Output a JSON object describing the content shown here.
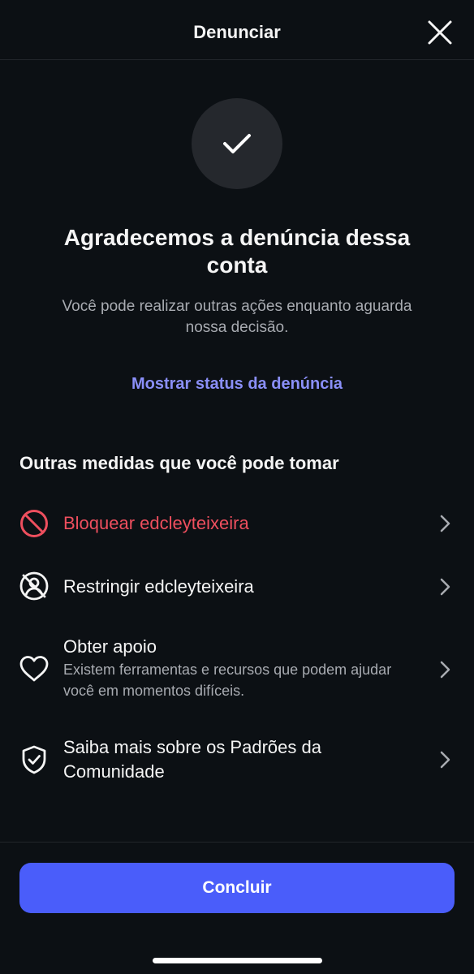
{
  "header": {
    "title": "Denunciar",
    "close_icon": "close-icon"
  },
  "confirmation": {
    "icon": "checkmark-icon",
    "title": "Agradecemos a denúncia dessa conta",
    "subtitle": "Você pode realizar outras ações enquanto aguarda nossa decisão.",
    "status_link": "Mostrar status da denúncia"
  },
  "actions": {
    "section_title": "Outras medidas que você pode tomar",
    "items": [
      {
        "label": "Bloquear edcleyteixeira",
        "icon": "block-icon",
        "danger": true
      },
      {
        "label": "Restringir edcleyteixeira",
        "icon": "restrict-icon"
      },
      {
        "label": "Obter apoio",
        "description": "Existem ferramentas e recursos que podem ajudar você em momentos difíceis.",
        "icon": "heart-icon"
      },
      {
        "label": "Saiba mais sobre os Padrões da Comunidade",
        "icon": "shield-check-icon"
      }
    ]
  },
  "footer": {
    "done_label": "Concluir"
  },
  "colors": {
    "background": "#0c1014",
    "accent": "#4a5dfa",
    "link": "#8a8ff8",
    "danger": "#ee4f5e",
    "muted_text": "#a8abb1"
  }
}
